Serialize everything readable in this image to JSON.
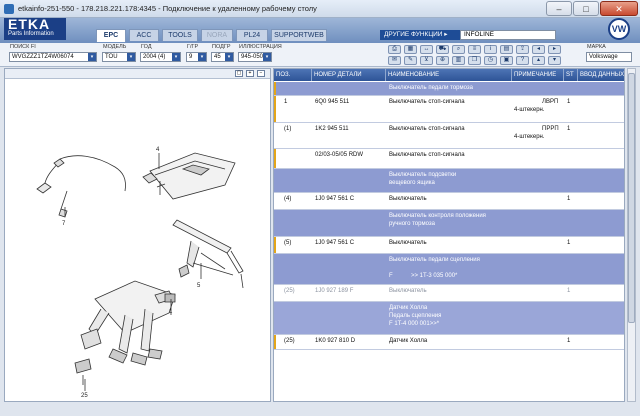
{
  "window": {
    "title": "etkainfo-251-550 - 178.218.221.178:4345 - Подключение к удаленному рабочему столу",
    "minimize": "–",
    "maximize": "□",
    "close": "✕"
  },
  "app": {
    "logo_line1": "ETKA",
    "logo_line2": "Parts Information",
    "brand_logo": "VW"
  },
  "tabs": [
    {
      "label": "EPC"
    },
    {
      "label": "ACC"
    },
    {
      "label": "TOOLS"
    },
    {
      "label": "NORA"
    },
    {
      "label": "PL24"
    },
    {
      "label": "SUPPORTWEB"
    }
  ],
  "functions": {
    "other_functions": "ДРУГИЕ ФУНКЦИИ ▸",
    "infoline": "INFOLINE"
  },
  "filters": {
    "search_fi_label": "ПОИСК FI",
    "search_fi_value": "WVGZZZ1TZ4W06074",
    "model_label": "МОДЕЛЬ",
    "model_value": "TOU",
    "year_label": "ГОД",
    "year_value": "2004 (4)",
    "group_label": "Г/ГР",
    "group_value": "9",
    "subgroup_label": "ПОДГР",
    "subgroup_value": "45",
    "illustration_label": "ИЛЛЮСТРАЦИЯ",
    "illustration_value": "945-050",
    "brand_label": "МАРКА",
    "brand_value": "Volkswage"
  },
  "icons": {
    "dropdown": "▾",
    "toolbar": [
      "print-icon",
      "calc-icon",
      "link-icon",
      "cart-icon",
      "search-icon",
      "list-icon",
      "info-icon",
      "back-icon",
      "forward-icon"
    ]
  },
  "drawing": {
    "callouts": [
      "4",
      "7",
      "5",
      "1",
      "25"
    ]
  },
  "grid": {
    "columns": [
      "ПОЗ.",
      "НОМЕР ДЕТАЛИ",
      "НАИМЕНОВАНИЕ",
      "ПРИМЕЧАНИЕ",
      "ST",
      "ВВОД ДАННЫХ"
    ],
    "rows": [
      {
        "pos": "",
        "part": "",
        "name": "Выключатель педали тормоза",
        "note": "",
        "note2": "",
        "st": "",
        "kind": "info",
        "mark": true
      },
      {
        "pos": "1",
        "part": "6Q0 945 511",
        "name": "Выключатель стоп-сигнала",
        "note": "ЛВРП",
        "note2": "4-штекерн.",
        "st": "1",
        "kind": "white",
        "mark": true
      },
      {
        "pos": "(1)",
        "part": "1K2 945 511",
        "name": "Выключатель стоп-сигнала",
        "note": "ПРРП",
        "note2": "4-штекерн.",
        "st": "1",
        "kind": "white",
        "mark": false
      },
      {
        "pos": "",
        "part": "02/03-05/05 RDW",
        "name": "Выключатель стоп-сигнала",
        "note": "",
        "note2": "",
        "st": "",
        "kind": "white",
        "mark": true
      },
      {
        "pos": "",
        "part": "",
        "name": "Выключатель подсветки\nвещевого ящика",
        "note": "",
        "note2": "",
        "st": "",
        "kind": "info",
        "mark": false
      },
      {
        "pos": "(4)",
        "part": "1J0 947 561 C",
        "name": "Выключатель",
        "note": "",
        "note2": "",
        "st": "1",
        "kind": "white",
        "mark": false
      },
      {
        "pos": "",
        "part": "",
        "name": "Выключатель контроля положения\nручного тормоза",
        "note": "",
        "note2": "",
        "st": "",
        "kind": "info",
        "mark": false
      },
      {
        "pos": "(5)",
        "part": "1J0 947 561 C",
        "name": "Выключатель",
        "note": "",
        "note2": "",
        "st": "1",
        "kind": "white",
        "mark": true
      },
      {
        "pos": "",
        "part": "",
        "name": "Выключатель педали сцепления\n\nF           >> 1T-3 035 000*",
        "note": "",
        "note2": "",
        "st": "",
        "kind": "info",
        "mark": false
      },
      {
        "pos": "(25)",
        "part": "1J0 927 189 F",
        "name": "Выключатель",
        "note": "",
        "note2": "",
        "st": "1",
        "kind": "grey",
        "mark": false
      },
      {
        "pos": "",
        "part": "",
        "name": "Датчик Холла\nПедаль сцепления\nF 1T-4 000 001>>*",
        "note": "",
        "note2": "",
        "st": "",
        "kind": "note",
        "mark": false
      },
      {
        "pos": "(25)",
        "part": "1K0 927 810 D",
        "name": "Датчик Холла",
        "note": "",
        "note2": "",
        "st": "1",
        "kind": "white",
        "mark": true
      }
    ]
  }
}
